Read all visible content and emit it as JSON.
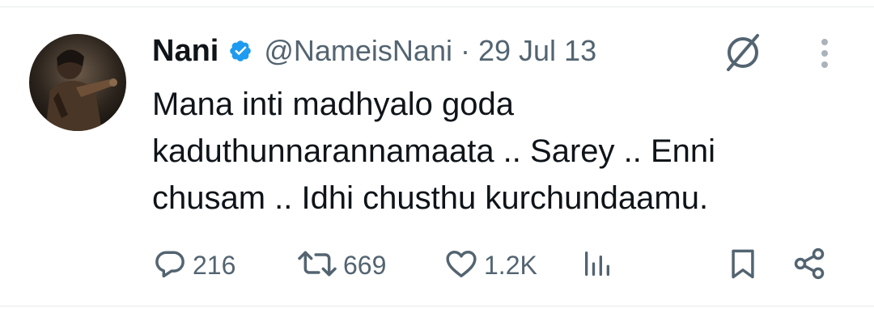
{
  "tweet": {
    "author": {
      "name": "Nani",
      "handle": "@NameisNani",
      "verified": true
    },
    "separator": "·",
    "date": "29 Jul 13",
    "text_lines": [
      "Mana inti madhyalo goda",
      "kaduthunnarannamaata .. Sarey .. Enni",
      "chusam .. Idhi chusthu kurchundaamu."
    ]
  },
  "actions": {
    "reply_count": "216",
    "retweet_count": "669",
    "like_count": "1.2K"
  },
  "icons": {
    "verified": "verified-badge-icon",
    "grok": "grok-icon",
    "more": "more-vertical-icon",
    "reply": "reply-icon",
    "retweet": "retweet-icon",
    "like": "heart-icon",
    "views": "views-icon",
    "bookmark": "bookmark-icon",
    "share": "share-icon"
  },
  "colors": {
    "text": "#0f1419",
    "secondary": "#536471",
    "verified_blue": "#1d9bf0",
    "divider": "#e6e8ea"
  }
}
